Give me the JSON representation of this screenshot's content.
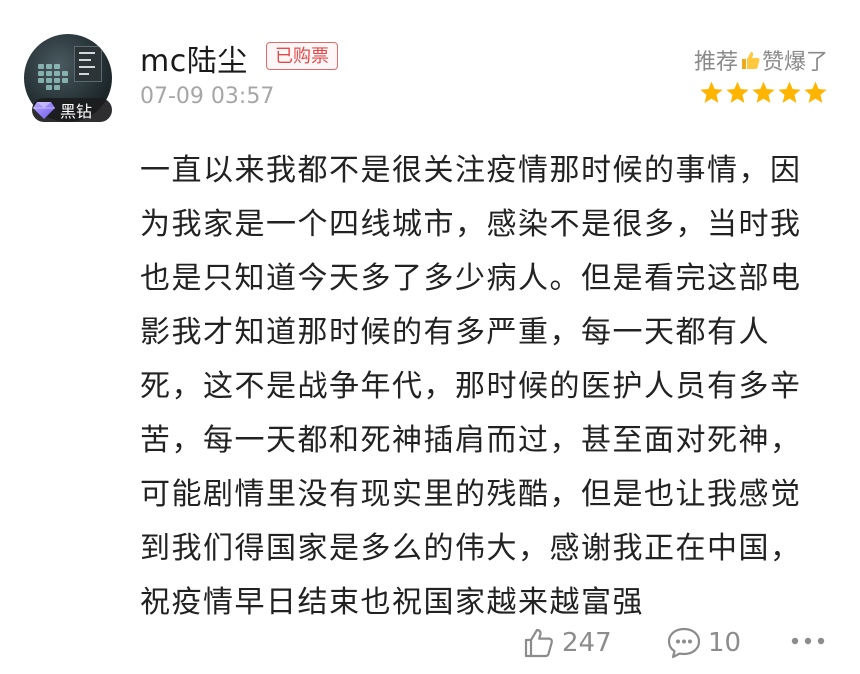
{
  "comment": {
    "author": {
      "name": "mc陆尘",
      "member_badge": "黑钻",
      "ticket_badge": "已购票"
    },
    "timestamp": "07-09 03:57",
    "rating": {
      "label_before": "推荐",
      "label_after": "赞爆了",
      "stars": 5,
      "max_stars": 5
    },
    "body": "一直以来我都不是很关注疫情那时候的事情，因为我家是一个四线城市，感染不是很多，当时我也是只知道今天多了多少病人。但是看完这部电影我才知道那时候的有多严重，每一天都有人死，这不是战争年代，那时候的医护人员有多辛苦，每一天都和死神插肩而过，甚至面对死神，可能剧情里没有现实里的残酷，但是也让我感觉到我们得国家是多么的伟大，感谢我正在中国，祝疫情早日结束也祝国家越来越富强",
    "actions": {
      "likes": "247",
      "replies": "10"
    }
  },
  "colors": {
    "star": "#FFB400",
    "ticket_badge": "#E04B4B",
    "secondary_text": "#A6A6A6",
    "action_icon": "#8C8C8C"
  },
  "icons": {
    "like": "thumbs-up-outline",
    "reply": "speech-bubble-dots",
    "more": "horizontal-ellipsis",
    "diamond": "diamond-gem",
    "thumb_emoji": "thumbs-up-emoji"
  }
}
